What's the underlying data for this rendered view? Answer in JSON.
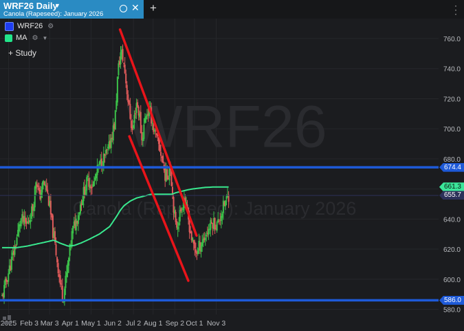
{
  "tab": {
    "title": "WRF26 Daily",
    "subtitle": "Canola (Rapeseed): January 2026"
  },
  "legend": {
    "items": [
      {
        "label": "WRF26",
        "color": "#1f3df0"
      },
      {
        "label": "MA",
        "color": "#22e58a"
      }
    ]
  },
  "study_button": {
    "label": "+ Study"
  },
  "watermark": {
    "symbol": "WRF26",
    "name": "Canola (Rapeseed): January 2026"
  },
  "price_tags": [
    {
      "label": "674.4",
      "value": 674.4,
      "bg": "#1e5ad8",
      "fg": "#ffffff"
    },
    {
      "label": "661.3",
      "value": 661.3,
      "bg": "#3be69a",
      "fg": "#0b1a12"
    },
    {
      "label": "655.7",
      "value": 655.7,
      "bg": "#2c3159",
      "fg": "#ffffff"
    },
    {
      "label": "586.0",
      "value": 586.0,
      "bg": "#1e5ad8",
      "fg": "#ffffff"
    }
  ],
  "chart_data": {
    "type": "candlestick",
    "y_ticks": [
      760,
      740,
      720,
      700,
      680,
      660,
      640,
      620,
      600,
      580
    ],
    "ylim": [
      575,
      774
    ],
    "x_ticks": [
      {
        "label": "2025",
        "t": 0.115
      },
      {
        "label": "Feb 3",
        "t": 1.115
      },
      {
        "label": "Mar 3",
        "t": 2.1
      },
      {
        "label": "Apr 1",
        "t": 3.1
      },
      {
        "label": "May 1",
        "t": 4.1
      },
      {
        "label": "Jun 2",
        "t": 5.15
      },
      {
        "label": "Jul 2",
        "t": 6.15
      },
      {
        "label": "Aug 1",
        "t": 7.1
      },
      {
        "label": "Sep 2",
        "t": 8.15
      },
      {
        "label": "Oct 1",
        "t": 9.1
      },
      {
        "label": "Nov 3",
        "t": 10.15
      }
    ],
    "up_color": "#3cc24a",
    "down_color": "#e05a5a",
    "ohlc_anchors": [
      [
        -0.2,
        588
      ],
      [
        0.1,
        604
      ],
      [
        0.4,
        620
      ],
      [
        0.7,
        640
      ],
      [
        1.0,
        636
      ],
      [
        1.3,
        648
      ],
      [
        1.45,
        668
      ],
      [
        1.6,
        654
      ],
      [
        1.8,
        664
      ],
      [
        1.95,
        660
      ],
      [
        2.1,
        648
      ],
      [
        2.25,
        632
      ],
      [
        2.45,
        614
      ],
      [
        2.6,
        598
      ],
      [
        2.75,
        588
      ],
      [
        2.95,
        606
      ],
      [
        3.2,
        632
      ],
      [
        3.45,
        642
      ],
      [
        3.7,
        656
      ],
      [
        3.95,
        666
      ],
      [
        4.2,
        662
      ],
      [
        4.45,
        674
      ],
      [
        4.7,
        680
      ],
      [
        4.95,
        686
      ],
      [
        5.1,
        696
      ],
      [
        5.25,
        704
      ],
      [
        5.4,
        738
      ],
      [
        5.55,
        752
      ],
      [
        5.7,
        742
      ],
      [
        5.8,
        730
      ],
      [
        5.95,
        712
      ],
      [
        6.1,
        698
      ],
      [
        6.3,
        718
      ],
      [
        6.45,
        708
      ],
      [
        6.55,
        692
      ],
      [
        6.75,
        710
      ],
      [
        6.95,
        712
      ],
      [
        7.15,
        698
      ],
      [
        7.35,
        690
      ],
      [
        7.55,
        680
      ],
      [
        7.65,
        670
      ],
      [
        7.8,
        668
      ],
      [
        7.92,
        678
      ],
      [
        8.05,
        654
      ],
      [
        8.2,
        634
      ],
      [
        8.45,
        646
      ],
      [
        8.6,
        654
      ],
      [
        8.8,
        640
      ],
      [
        9.0,
        624
      ],
      [
        9.2,
        618
      ],
      [
        9.4,
        624
      ],
      [
        9.6,
        628
      ],
      [
        9.8,
        634
      ],
      [
        10.0,
        638
      ],
      [
        10.2,
        636
      ],
      [
        10.4,
        644
      ],
      [
        10.55,
        650
      ],
      [
        10.75,
        656
      ]
    ],
    "ma_anchors": [
      [
        -0.2,
        621
      ],
      [
        0.5,
        621
      ],
      [
        1.0,
        622
      ],
      [
        1.5,
        623.5
      ],
      [
        2.0,
        625
      ],
      [
        2.3,
        626
      ],
      [
        2.6,
        624
      ],
      [
        3.0,
        622
      ],
      [
        3.3,
        622.5
      ],
      [
        3.6,
        624
      ],
      [
        4.0,
        626.5
      ],
      [
        4.5,
        630
      ],
      [
        5.0,
        635
      ],
      [
        5.3,
        641
      ],
      [
        5.5,
        645.5
      ],
      [
        5.7,
        649
      ],
      [
        6.0,
        652
      ],
      [
        6.3,
        654
      ],
      [
        6.6,
        655
      ],
      [
        7.0,
        656.5
      ],
      [
        7.3,
        656.5
      ],
      [
        7.5,
        656.5
      ],
      [
        7.8,
        656.5
      ],
      [
        8.0,
        656.5
      ],
      [
        8.2,
        657.5
      ],
      [
        8.5,
        658.5
      ],
      [
        8.8,
        659.5
      ],
      [
        9.0,
        660
      ],
      [
        9.3,
        660.5
      ],
      [
        9.6,
        661
      ],
      [
        10.0,
        661.3
      ],
      [
        10.75,
        661.3
      ]
    ],
    "horizontal_lines": [
      {
        "value": 674.4,
        "color": "#1e5ad8",
        "width": 3.5
      },
      {
        "value": 655.7,
        "color": "#2c3159",
        "width": 1
      },
      {
        "value": 586.0,
        "color": "#1e5ad8",
        "width": 3.5
      }
    ],
    "trend_lines": [
      {
        "t1": 5.5,
        "v1": 766,
        "t2": 9.2,
        "v2": 629,
        "color": "#e8141a"
      },
      {
        "t1": 5.95,
        "v1": 695,
        "t2": 8.8,
        "v2": 599,
        "color": "#e8141a"
      }
    ]
  }
}
